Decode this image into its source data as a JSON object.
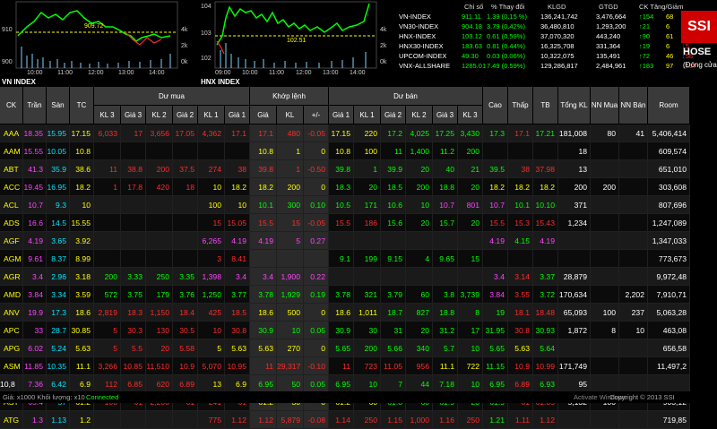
{
  "charts": {
    "left": {
      "label": "VN INDEX",
      "y_ticks": [
        "910",
        "900"
      ],
      "y2_ticks": [
        "4k",
        "2k",
        "0k"
      ],
      "x_ticks": [
        "10:00",
        "11:00",
        "12:00",
        "13:00",
        "14:00"
      ],
      "ref_value": "909.72"
    },
    "right": {
      "label": "HNX INDEX",
      "y_ticks": [
        "104",
        "103",
        "102"
      ],
      "y2_ticks": [
        "4k",
        "2k",
        "0k"
      ],
      "x_ticks": [
        "09:00",
        "10:00",
        "11:00",
        "12:00",
        "13:00",
        "14:00"
      ],
      "ref_value": "102.51"
    }
  },
  "index_header": [
    "Chỉ số",
    "% Thay đổi",
    "KLGD",
    "GTGD",
    "CK Tăng/Giảm"
  ],
  "indices": [
    {
      "name": "VN-INDEX",
      "value": "911.11",
      "change": "1.39 (0.15 %)",
      "klgd": "136,241,742",
      "gtgd": "3,476,664",
      "up": "154",
      "ref": "68",
      "down": "107"
    },
    {
      "name": "VN30-INDEX",
      "value": "904.18",
      "change": "3.79 (0.42%)",
      "klgd": "36,480,810",
      "gtgd": "1,293,200",
      "up": "21",
      "ref": "6",
      "down": "3"
    },
    {
      "name": "HNX-INDEX",
      "value": "103.12",
      "change": "0.61 (0.59%)",
      "klgd": "37,070,320",
      "gtgd": "443,240",
      "up": "90",
      "ref": "61",
      "down": "63"
    },
    {
      "name": "HNX30-INDEX",
      "value": "183.63",
      "change": "0.81 (0.44%)",
      "klgd": "16,325,708",
      "gtgd": "331,364",
      "up": "19",
      "ref": "6",
      "down": "5"
    },
    {
      "name": "UPCOM-INDEX",
      "value": "49.30",
      "change": "0.03 (0.06%)",
      "klgd": "10,322,075",
      "gtgd": "135,491",
      "up": "72",
      "ref": "46",
      "down": "58"
    },
    {
      "name": "VNX-ALLSHARE",
      "value": "1285.01",
      "change": "7.49 (0.59%)",
      "klgd": "129,286,817",
      "gtgd": "2,484,961",
      "up": "183",
      "ref": "97",
      "down": "137"
    }
  ],
  "logo": {
    "brand": "SSI",
    "exchange": "HOSE",
    "status": "(Đóng cửa)"
  },
  "table": {
    "groups": {
      "du_mua": "Dư mua",
      "khop_lenh": "Khớp lệnh",
      "du_ban": "Dư bán"
    },
    "headers": [
      "CK",
      "Trần",
      "Sàn",
      "TC",
      "KL 3",
      "Giá 3",
      "KL 2",
      "Giá 2",
      "KL 1",
      "Giá 1",
      "Giá",
      "KL",
      "+/-",
      "Giá 1",
      "KL 1",
      "Giá 2",
      "KL 2",
      "Giá 3",
      "KL 3",
      "Cao",
      "Thấp",
      "TB",
      "Tổng KL",
      "NN Mua",
      "NN Bán",
      "Room"
    ],
    "rows": [
      {
        "c": [
          "AAA",
          "18.35",
          "15.95",
          "17.15",
          "6,033",
          "17",
          "3,656",
          "17.05",
          "4,362",
          "17.1",
          "17.1",
          "480",
          "-0.05",
          "17.15",
          "220",
          "17.2",
          "4,025",
          "17.25",
          "3,430",
          "17.3",
          "17.1",
          "17.21",
          "181,008",
          "80",
          "41",
          "5,406,414"
        ],
        "k": [
          "y",
          "m",
          "c",
          "y",
          "r",
          "r",
          "r",
          "r",
          "r",
          "r",
          "r",
          "r",
          "r",
          "y",
          "y",
          "g",
          "g",
          "g",
          "g",
          "g",
          "r",
          "g",
          "w",
          "w",
          "w",
          "w"
        ]
      },
      {
        "c": [
          "AAM",
          "15.55",
          "10.05",
          "10.8",
          "",
          "",
          "",
          "",
          "",
          "",
          "10.8",
          "1",
          "0",
          "10.8",
          "100",
          "11",
          "1,400",
          "11.2",
          "200",
          "",
          "",
          "",
          "18",
          "",
          "",
          "609,574"
        ],
        "k": [
          "y",
          "m",
          "c",
          "y",
          "w",
          "w",
          "w",
          "w",
          "w",
          "w",
          "y",
          "y",
          "y",
          "y",
          "y",
          "g",
          "g",
          "g",
          "g",
          "w",
          "w",
          "w",
          "w",
          "w",
          "w",
          "w"
        ]
      },
      {
        "c": [
          "ABT",
          "41.3",
          "35.9",
          "38.6",
          "11",
          "38.8",
          "200",
          "37.5",
          "274",
          "38",
          "39.8",
          "1",
          "-0.50",
          "39.8",
          "1",
          "39.9",
          "20",
          "40",
          "21",
          "39.5",
          "38",
          "37.98",
          "13",
          "",
          "",
          "651,010"
        ],
        "k": [
          "y",
          "m",
          "c",
          "y",
          "r",
          "r",
          "r",
          "r",
          "r",
          "r",
          "r",
          "r",
          "r",
          "g",
          "g",
          "g",
          "g",
          "g",
          "g",
          "g",
          "r",
          "r",
          "w",
          "w",
          "w",
          "w"
        ]
      },
      {
        "c": [
          "ACC",
          "19.45",
          "16.95",
          "18.2",
          "1",
          "17.8",
          "420",
          "18",
          "10",
          "18.2",
          "18.2",
          "200",
          "0",
          "18.3",
          "20",
          "18.5",
          "200",
          "18.8",
          "20",
          "18.2",
          "18.2",
          "18.2",
          "200",
          "200",
          "",
          "303,608"
        ],
        "k": [
          "y",
          "m",
          "c",
          "y",
          "r",
          "r",
          "r",
          "r",
          "y",
          "y",
          "y",
          "y",
          "y",
          "g",
          "g",
          "g",
          "g",
          "g",
          "g",
          "y",
          "y",
          "y",
          "w",
          "w",
          "w",
          "w"
        ]
      },
      {
        "c": [
          "ACL",
          "10.7",
          "9.3",
          "10",
          "",
          "",
          "",
          "",
          "100",
          "10",
          "10.1",
          "300",
          "0.10",
          "10.5",
          "171",
          "10.6",
          "10",
          "10.7",
          "801",
          "10.7",
          "10.1",
          "10.10",
          "371",
          "",
          "",
          "807,696"
        ],
        "k": [
          "y",
          "m",
          "c",
          "y",
          "w",
          "w",
          "w",
          "w",
          "y",
          "y",
          "g",
          "g",
          "g",
          "g",
          "g",
          "g",
          "g",
          "m",
          "m",
          "m",
          "g",
          "g",
          "w",
          "w",
          "w",
          "w"
        ]
      },
      {
        "c": [
          "ADS",
          "16.6",
          "14.5",
          "15.55",
          "",
          "",
          "",
          "",
          "15",
          "15.05",
          "15.5",
          "15",
          "-0.05",
          "15.5",
          "186",
          "15.6",
          "20",
          "15.7",
          "20",
          "15.5",
          "15.3",
          "15.43",
          "1,234",
          "",
          "",
          "1,247,089"
        ],
        "k": [
          "y",
          "m",
          "c",
          "y",
          "w",
          "w",
          "w",
          "w",
          "r",
          "r",
          "r",
          "r",
          "r",
          "r",
          "r",
          "g",
          "g",
          "g",
          "g",
          "r",
          "r",
          "r",
          "w",
          "w",
          "w",
          "w"
        ]
      },
      {
        "c": [
          "AGF",
          "4.19",
          "3.65",
          "3.92",
          "",
          "",
          "",
          "",
          "6,265",
          "4.19",
          "4.19",
          "5",
          "0.27",
          "",
          "",
          "",
          "",
          "",
          "",
          "4.19",
          "4.15",
          "4.19",
          "",
          "",
          "",
          "1,347,033"
        ],
        "k": [
          "y",
          "m",
          "c",
          "y",
          "w",
          "w",
          "w",
          "w",
          "m",
          "m",
          "m",
          "m",
          "m",
          "w",
          "w",
          "w",
          "w",
          "w",
          "w",
          "m",
          "g",
          "m",
          "w",
          "w",
          "w",
          "w"
        ]
      },
      {
        "c": [
          "AGM",
          "9.61",
          "8.37",
          "8.99",
          "",
          "",
          "",
          "",
          "3",
          "8.41",
          "",
          "",
          "",
          "9.1",
          "199",
          "9.15",
          "4",
          "9.65",
          "15",
          "",
          "",
          "",
          "",
          "",
          "",
          "773,673"
        ],
        "k": [
          "y",
          "m",
          "c",
          "y",
          "w",
          "w",
          "w",
          "w",
          "r",
          "r",
          "w",
          "w",
          "w",
          "g",
          "g",
          "g",
          "g",
          "g",
          "g",
          "w",
          "w",
          "w",
          "w",
          "w",
          "w",
          "w"
        ]
      },
      {
        "c": [
          "AGR",
          "3.4",
          "2.96",
          "3.18",
          "200",
          "3.33",
          "250",
          "3.35",
          "1,398",
          "3.4",
          "3.4",
          "1,900",
          "0.22",
          "",
          "",
          "",
          "",
          "",
          "",
          "3.4",
          "3.14",
          "3.37",
          "28,879",
          "",
          "",
          "9,972,48"
        ],
        "k": [
          "y",
          "m",
          "c",
          "y",
          "g",
          "g",
          "g",
          "g",
          "m",
          "m",
          "m",
          "m",
          "m",
          "w",
          "w",
          "w",
          "w",
          "w",
          "w",
          "m",
          "r",
          "g",
          "w",
          "w",
          "w",
          "w"
        ]
      },
      {
        "c": [
          "AMD",
          "3.84",
          "3.34",
          "3.59",
          "572",
          "3.75",
          "179",
          "3.76",
          "1,250",
          "3.77",
          "3.78",
          "1,929",
          "0.19",
          "3.78",
          "321",
          "3.79",
          "60",
          "3.8",
          "3,739",
          "3.84",
          "3.55",
          "3.72",
          "170,634",
          "",
          "2,202",
          "7,910,71"
        ],
        "k": [
          "y",
          "m",
          "c",
          "y",
          "g",
          "g",
          "g",
          "g",
          "g",
          "g",
          "g",
          "g",
          "g",
          "g",
          "g",
          "g",
          "g",
          "g",
          "g",
          "m",
          "r",
          "g",
          "w",
          "w",
          "w",
          "w"
        ]
      },
      {
        "c": [
          "ANV",
          "19.9",
          "17.3",
          "18.6",
          "2,819",
          "18.3",
          "1,150",
          "18.4",
          "425",
          "18.5",
          "18.6",
          "500",
          "0",
          "18.6",
          "1,011",
          "18.7",
          "827",
          "18.8",
          "8",
          "19",
          "18.1",
          "18.48",
          "65,093",
          "100",
          "237",
          "5,063,28"
        ],
        "k": [
          "y",
          "m",
          "c",
          "y",
          "r",
          "r",
          "r",
          "r",
          "r",
          "r",
          "y",
          "y",
          "y",
          "y",
          "y",
          "g",
          "g",
          "g",
          "g",
          "g",
          "r",
          "r",
          "w",
          "w",
          "w",
          "w"
        ]
      },
      {
        "c": [
          "APC",
          "33",
          "28.7",
          "30.85",
          "5",
          "30.3",
          "130",
          "30.5",
          "10",
          "30.8",
          "30.9",
          "10",
          "0.05",
          "30.9",
          "30",
          "31",
          "20",
          "31.2",
          "17",
          "31.95",
          "30.8",
          "30.93",
          "1,872",
          "8",
          "10",
          "463,08"
        ],
        "k": [
          "y",
          "m",
          "c",
          "y",
          "r",
          "r",
          "r",
          "r",
          "r",
          "r",
          "g",
          "g",
          "g",
          "g",
          "g",
          "g",
          "g",
          "g",
          "g",
          "g",
          "r",
          "g",
          "w",
          "w",
          "w",
          "w"
        ]
      },
      {
        "c": [
          "APG",
          "6.02",
          "5.24",
          "5.63",
          "5",
          "5.5",
          "20",
          "5.58",
          "5",
          "5.63",
          "5.63",
          "270",
          "0",
          "5.65",
          "200",
          "5.66",
          "340",
          "5.7",
          "10",
          "5.65",
          "5.63",
          "5.64",
          "",
          "",
          "",
          "656,58"
        ],
        "k": [
          "y",
          "m",
          "c",
          "y",
          "r",
          "r",
          "r",
          "r",
          "y",
          "y",
          "y",
          "y",
          "y",
          "g",
          "g",
          "g",
          "g",
          "g",
          "g",
          "g",
          "y",
          "g",
          "w",
          "w",
          "w",
          "w"
        ]
      },
      {
        "c": [
          "ASM",
          "11.85",
          "10.35",
          "11.1",
          "3,266",
          "10.85",
          "11,510",
          "10.9",
          "5,070",
          "10.95",
          "11",
          "29,317",
          "-0.10",
          "11",
          "723",
          "11.05",
          "956",
          "11.1",
          "722",
          "11.15",
          "10.9",
          "10.99",
          "171,749",
          "",
          "",
          "11,497,2"
        ],
        "k": [
          "y",
          "m",
          "c",
          "y",
          "r",
          "r",
          "r",
          "r",
          "r",
          "r",
          "r",
          "r",
          "r",
          "r",
          "r",
          "r",
          "r",
          "y",
          "y",
          "g",
          "r",
          "r",
          "w",
          "w",
          "w",
          "w"
        ]
      },
      {
        "c": [
          "ASP",
          "7.36",
          "6.42",
          "6.9",
          "112",
          "6.85",
          "620",
          "6.89",
          "13",
          "6.9",
          "6.95",
          "50",
          "0.05",
          "6.95",
          "10",
          "7",
          "44",
          "7.18",
          "10",
          "6.95",
          "6.89",
          "6.93",
          "95",
          "",
          "",
          "",
          "10,8"
        ],
        "k": [
          "y",
          "m",
          "c",
          "y",
          "r",
          "r",
          "r",
          "r",
          "y",
          "y",
          "g",
          "g",
          "g",
          "g",
          "g",
          "g",
          "g",
          "g",
          "g",
          "g",
          "r",
          "g",
          "w",
          "w",
          "w",
          "w"
        ]
      },
      {
        "c": [
          "AST",
          "65.4",
          "57",
          "61.2",
          "100",
          "61",
          "2,200",
          "61",
          "241",
          "61",
          "61.2",
          "30",
          "0",
          "61.2",
          "60",
          "61.8",
          "60",
          "61.9",
          "20",
          "61.9",
          "61",
          "61.05",
          "5,132",
          "100",
          "",
          "903,12"
        ],
        "k": [
          "y",
          "m",
          "c",
          "y",
          "r",
          "r",
          "r",
          "r",
          "r",
          "r",
          "y",
          "y",
          "y",
          "y",
          "y",
          "g",
          "g",
          "g",
          "g",
          "g",
          "r",
          "r",
          "w",
          "w",
          "w",
          "w"
        ]
      },
      {
        "c": [
          "ATG",
          "1.3",
          "1.13",
          "1.2",
          "",
          "",
          "",
          "",
          "775",
          "1.12",
          "1.12",
          "5,879",
          "-0.08",
          "1.14",
          "250",
          "1.15",
          "1,000",
          "1.16",
          "250",
          "1.21",
          "1.11",
          "1.12",
          "",
          "",
          "",
          "719,85"
        ],
        "k": [
          "y",
          "m",
          "c",
          "y",
          "w",
          "w",
          "w",
          "w",
          "r",
          "r",
          "r",
          "r",
          "r",
          "r",
          "r",
          "r",
          "r",
          "r",
          "r",
          "g",
          "r",
          "r",
          "w",
          "w",
          "w",
          "w"
        ]
      }
    ]
  },
  "footer": {
    "units": "Giá: x1000 Khối lượng: x10",
    "status": "Connected",
    "copyright": "Copyright © 2013 SSI",
    "watermark": "Activate Windows"
  }
}
